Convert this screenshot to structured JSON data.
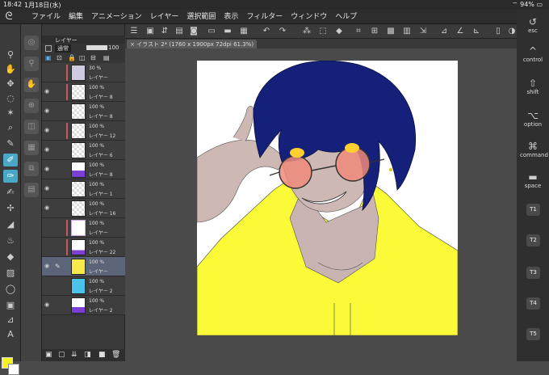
{
  "status": {
    "time": "18:42",
    "date": "1月18日(水)",
    "battery": "94%"
  },
  "menu": [
    "ファイル",
    "編集",
    "アニメーション",
    "レイヤー",
    "選択範囲",
    "表示",
    "フィルター",
    "ウィンドウ",
    "ヘルプ"
  ],
  "canvas_tab": "イラスト 2* (1760 x 1900px 72dpi 61.3%)",
  "layer_panel": {
    "title": "レイヤー",
    "blend": "通常",
    "opacity": "100"
  },
  "layers": [
    {
      "pct": "30 %",
      "name": "レイヤー",
      "thumb": "#cfc9e0"
    },
    {
      "pct": "100 %",
      "name": "レイヤー 8",
      "thumb": "#2b3a8f"
    },
    {
      "pct": "100 %",
      "name": "レイヤー 8",
      "thumb": "#ffffff"
    },
    {
      "pct": "100 %",
      "name": "レイヤー 12",
      "thumb": "#ffffff"
    },
    {
      "pct": "100 %",
      "name": "レイヤー 6",
      "thumb": "#ffffff"
    },
    {
      "pct": "100 %",
      "name": "レイヤー 8",
      "thumb": "#7b3fd6"
    },
    {
      "pct": "100 %",
      "name": "レイヤー 1",
      "thumb": "#ffffff"
    },
    {
      "pct": "100 %",
      "name": "レイヤー 16",
      "thumb": "#ffffff"
    },
    {
      "pct": "100 %",
      "name": "レイヤー",
      "thumb": "#c8a8e8"
    },
    {
      "pct": "100 %",
      "name": "レイヤー 22",
      "thumb": "#ffffff"
    },
    {
      "pct": "100 %",
      "name": "レイヤー",
      "thumb": "#f7e94a"
    },
    {
      "pct": "100 %",
      "name": "レイヤー 2",
      "thumb": "#4ac3e8"
    },
    {
      "pct": "100 %",
      "name": "レイヤー 2",
      "thumb": "#7b3fd6"
    }
  ],
  "right_panel": {
    "esc": "esc",
    "control": "control",
    "shift": "shift",
    "option": "option",
    "command": "command",
    "space": "space",
    "t_keys": [
      "T1",
      "T2",
      "T3",
      "T4",
      "T5"
    ]
  },
  "colors": {
    "main": "#f6f02a",
    "sub": "#ffffff",
    "accent": "#4aa8c7"
  }
}
